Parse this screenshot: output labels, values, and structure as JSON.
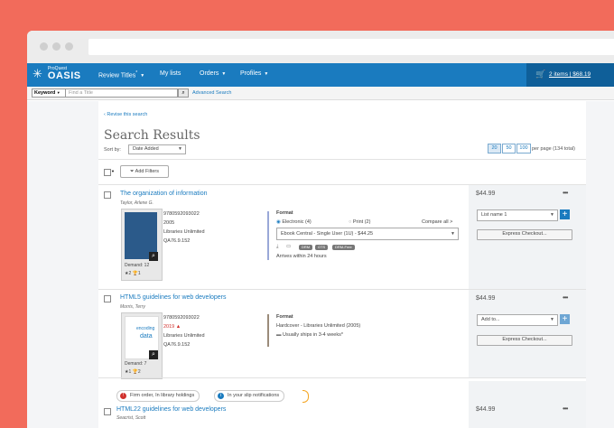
{
  "nav": {
    "brand_small": "ProQuest",
    "brand": "OASIS",
    "items": [
      "Review Titles",
      "My lists",
      "Orders",
      "Profiles"
    ],
    "review_star": "*",
    "cart": "2 items | $68.19"
  },
  "search": {
    "field": "Keyword",
    "placeholder": "Find a Title",
    "advanced": "Advanced Search"
  },
  "main": {
    "revise": "Revise this search",
    "title": "Search Results",
    "sort_label": "Sort by:",
    "sort_value": "Date Added",
    "page_sizes": [
      "20",
      "50",
      "100"
    ],
    "per_page": "per page (134 total)",
    "add_filters": "Add Filters"
  },
  "results": [
    {
      "title": "The organization of information",
      "author": "Taylor, Arlene G.",
      "isbn": "9780592093022",
      "year": "2005",
      "publisher": "Libraries Unlimited",
      "callno": "QA76.9.152",
      "demand": "Demand: 12",
      "stars": "2",
      "trophies": "1",
      "format_label": "Format",
      "opt_electronic": "Electronic (4)",
      "opt_print": "Print (2)",
      "compare": "Compare all >",
      "edition_select": "Ebook Central - Single User (1U) - $44.25",
      "badges": [
        "DRM",
        "OTS",
        "DRM-Free"
      ],
      "ship": "Arrives within 24 hours",
      "price": "$44.99",
      "list_select": "List name 1",
      "checkout": "Express Checkout..."
    },
    {
      "title": "HTML5 guidelines for web developers",
      "author": "Morris, Terry",
      "isbn": "9780592093022",
      "year": "2019",
      "publisher": "Libraries Unlimited",
      "callno": "QA76.9.152",
      "demand": "Demand: 7",
      "stars": "1",
      "trophies": "2",
      "format_label": "Format",
      "format_value": "Hardcover - Libraries Unlimited (2005)",
      "ship": "Usually ships in 3-4 weeks*",
      "price": "$44.99",
      "list_select": "Add to...",
      "checkout": "Express Checkout..."
    },
    {
      "title": "HTML22 guidelines for web developers",
      "author": "Seacrist, Scott",
      "price": "$44.99"
    }
  ],
  "notes": {
    "firm_order": "Firm order, In library holdings",
    "slip": "In your slip notifications"
  },
  "colors": {
    "background": "#f26b5b",
    "nav": "#1a7bbf",
    "accent": "#1a7bbf",
    "alert": "#d0312d"
  }
}
